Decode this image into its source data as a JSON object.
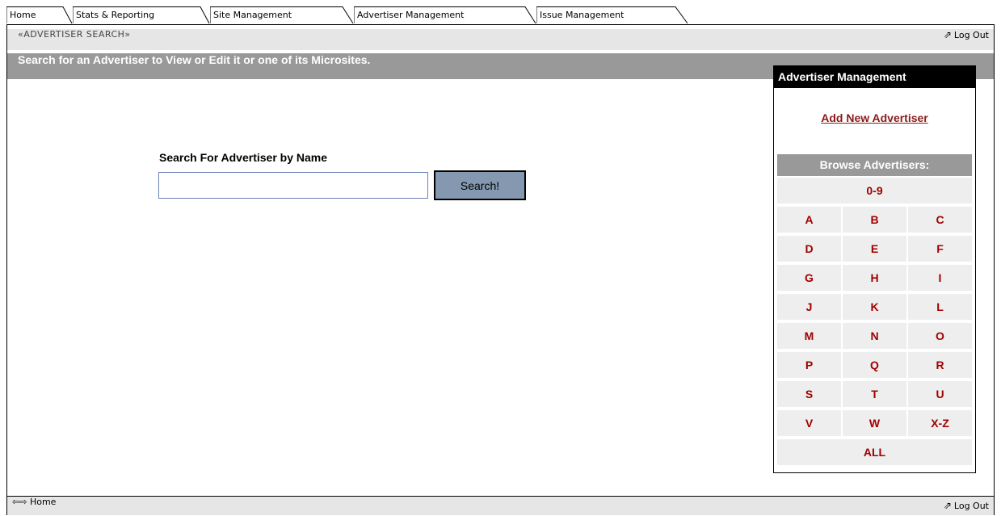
{
  "tabs": [
    {
      "label": "Home"
    },
    {
      "label": "Stats & Reporting"
    },
    {
      "label": "Site Management"
    },
    {
      "label": "Advertiser Management"
    },
    {
      "label": "Issue Management"
    }
  ],
  "active_tab": "Advertiser Management",
  "breadcrumb": "«ADVERTISER SEARCH»",
  "logout_label": "Log Out",
  "instruction": "Search for an Advertiser to View or Edit it or one of its Microsites.",
  "search": {
    "label": "Search For Advertiser by Name",
    "value": "",
    "button_label": "Search!"
  },
  "panel": {
    "title": "Advertiser Management",
    "add_link": "Add New Advertiser",
    "browse_label": "Browse Advertisers:",
    "letters_top": "0-9",
    "letters": [
      "A",
      "B",
      "C",
      "D",
      "E",
      "F",
      "G",
      "H",
      "I",
      "J",
      "K",
      "L",
      "M",
      "N",
      "O",
      "P",
      "Q",
      "R",
      "S",
      "T",
      "U",
      "V",
      "W",
      "X-Z"
    ],
    "letters_bottom": "ALL"
  },
  "footer": {
    "home_label": "Home",
    "logout_label": "Log Out"
  },
  "colors": {
    "accent_red": "#a00000",
    "link_red": "#8b1a1a",
    "bar_gray": "#999999",
    "light_gray": "#e6e6e6",
    "button_blue": "#8498b0"
  },
  "icons": {
    "logout": "logout-arrow-icon",
    "home": "home-arrow-icon"
  }
}
